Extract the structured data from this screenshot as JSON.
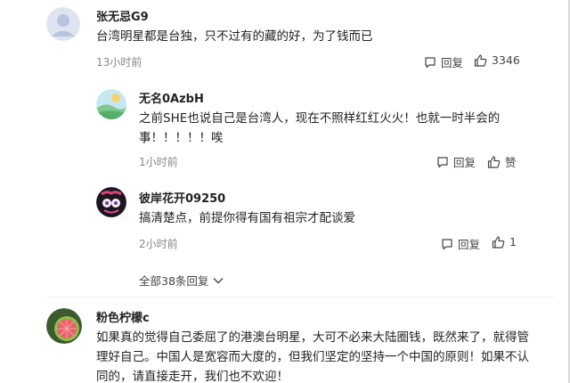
{
  "comments": [
    {
      "username": "张无忌G9",
      "content": "台湾明星都是台独，只不过有的藏的好，为了钱而已",
      "time": "13小时前",
      "reply_label": "回复",
      "like_count": "3346",
      "avatar_icon": "default-avatar-icon"
    },
    {
      "username": "无名0AzbH",
      "content": "之前SHE也说自己是台湾人，现在不照样红红火火！也就一时半会的事！！！！！唉",
      "time": "1小时前",
      "reply_label": "回复",
      "like_label": "赞",
      "avatar_icon": "landscape-avatar-icon"
    },
    {
      "username": "彼岸花开09250",
      "content": "搞清楚点，前提你得有国有祖宗才配谈爱",
      "time": "2小时前",
      "reply_label": "回复",
      "like_count": "1",
      "avatar_icon": "cartoon-avatar-icon"
    },
    {
      "username": "粉色柠檬c",
      "content": "如果真的觉得自己委屈了的港澳台明星，大可不必来大陆圈钱，既然来了，就得管理好自己。中国人是宽容而大度的，但我们坚定的坚持一个中国的原则！如果不认同的，请直接走开，我们也不欢迎！",
      "avatar_icon": "grapefruit-avatar-icon"
    }
  ],
  "expand_replies_label": "全部38条回复"
}
